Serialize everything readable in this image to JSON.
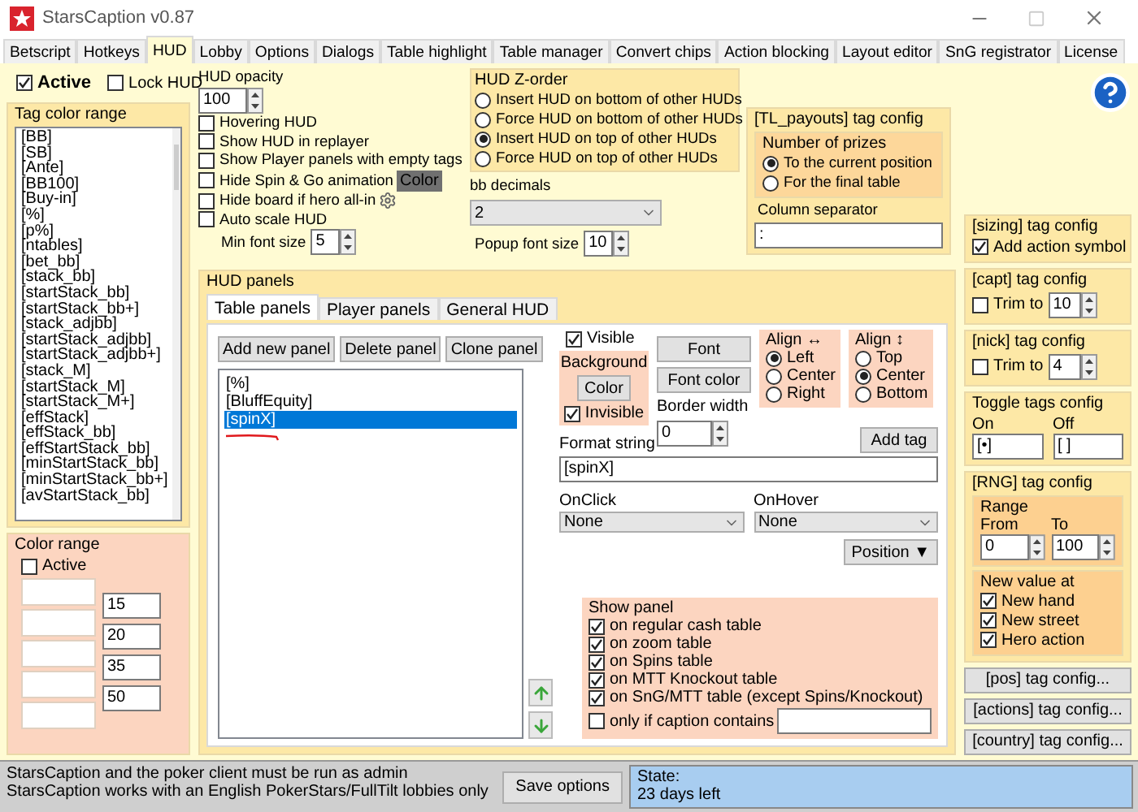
{
  "window": {
    "title": "StarsCaption v0.87"
  },
  "tabs": [
    {
      "label": "Betscript",
      "selected": false
    },
    {
      "label": "Hotkeys",
      "selected": false
    },
    {
      "label": "HUD",
      "selected": true
    },
    {
      "label": "Lobby",
      "selected": false
    },
    {
      "label": "Options",
      "selected": false
    },
    {
      "label": "Dialogs",
      "selected": false
    },
    {
      "label": "Table highlight",
      "selected": false
    },
    {
      "label": "Table manager",
      "selected": false
    },
    {
      "label": "Convert chips",
      "selected": false
    },
    {
      "label": "Action blocking",
      "selected": false
    },
    {
      "label": "Layout editor",
      "selected": false
    },
    {
      "label": "SnG registrator",
      "selected": false
    },
    {
      "label": "License",
      "selected": false
    }
  ],
  "left": {
    "active": {
      "label": "Active",
      "checked": true
    },
    "lock_hud": {
      "label": "Lock HUD",
      "checked": false
    },
    "tag_color_range": {
      "title": "Tag color range",
      "items": [
        "[BB]",
        "[SB]",
        "[Ante]",
        "[BB100]",
        "[Buy-in]",
        "[%]",
        "[p%]",
        "[ntables]",
        "[bet_bb]",
        "[stack_bb]",
        "[startStack_bb]",
        "[startStack_bb+]",
        "[stack_adjbb]",
        "[startStack_adjbb]",
        "[startStack_adjbb+]",
        "[stack_M]",
        "[startStack_M]",
        "[startStack_M+]",
        "[effStack]",
        "[effStack_bb]",
        "[effStartStack_bb]",
        "[minStartStack_bb]",
        "[minStartStack_bb+]",
        "[avStartStack_bb]"
      ]
    },
    "color_range": {
      "title": "Color range",
      "active": {
        "label": "Active",
        "checked": false
      },
      "thresholds": [
        "15",
        "20",
        "35",
        "50"
      ]
    }
  },
  "settings": {
    "hud_opacity": {
      "label": "HUD opacity",
      "value": "100"
    },
    "options": [
      {
        "label": "Hovering HUD",
        "checked": false,
        "kind": "plain"
      },
      {
        "label": "Show HUD in replayer",
        "checked": false,
        "kind": "plain"
      },
      {
        "label": "Show Player panels with empty tags",
        "checked": false,
        "kind": "plain"
      },
      {
        "label": "Hide Spin & Go animation",
        "checked": false,
        "kind": "button",
        "button": "Color"
      },
      {
        "label": "Hide board if hero all-in",
        "checked": false,
        "kind": "gear"
      },
      {
        "label": "Auto scale HUD",
        "checked": false,
        "kind": "plain"
      }
    ],
    "min_font_size": {
      "label": "Min font size",
      "value": "5"
    }
  },
  "z_order": {
    "title": "HUD Z-order",
    "options": [
      {
        "label": "Insert HUD on bottom of other HUDs",
        "selected": false
      },
      {
        "label": "Force HUD on bottom of other HUDs",
        "selected": false
      },
      {
        "label": "Insert HUD on top of other HUDs",
        "selected": true
      },
      {
        "label": "Force HUD on top of other HUDs",
        "selected": false
      }
    ]
  },
  "bb_decimals": {
    "label": "bb decimals",
    "value": "2"
  },
  "popup_font_size": {
    "label": "Popup font size",
    "value": "10"
  },
  "tl_payouts": {
    "title": "[TL_payouts] tag config",
    "prizes": {
      "title": "Number of prizes",
      "options": [
        {
          "label": "To the current position",
          "selected": true
        },
        {
          "label": "For the final table",
          "selected": false
        }
      ]
    },
    "separator": {
      "label": "Column separator",
      "value": ":"
    }
  },
  "hud_panels": {
    "title": "HUD panels",
    "tabs": [
      {
        "label": "Table panels",
        "selected": true
      },
      {
        "label": "Player panels",
        "selected": false
      },
      {
        "label": "General HUD",
        "selected": false
      }
    ],
    "buttons": [
      "Add new panel",
      "Delete panel",
      "Clone panel"
    ],
    "panels": [
      {
        "text": "[%]",
        "selected": false
      },
      {
        "text": "[BluffEquity]",
        "selected": false
      },
      {
        "text": "[spinX]",
        "selected": true
      }
    ],
    "visible": {
      "label": "Visible",
      "checked": true
    },
    "background": {
      "title": "Background",
      "button": "Color",
      "invisible": {
        "label": "Invisible",
        "checked": true
      }
    },
    "font_button": "Font",
    "font_color_button": "Font color",
    "border_width": {
      "label": "Border width",
      "value": "0"
    },
    "align_h": {
      "title": "Align ↔",
      "options": [
        {
          "label": "Left",
          "selected": true
        },
        {
          "label": "Center",
          "selected": false
        },
        {
          "label": "Right",
          "selected": false
        }
      ]
    },
    "align_v": {
      "title": "Align ↕",
      "options": [
        {
          "label": "Top",
          "selected": false
        },
        {
          "label": "Center",
          "selected": true
        },
        {
          "label": "Bottom",
          "selected": false
        }
      ]
    },
    "add_tag": "Add tag",
    "format_string": {
      "label": "Format string",
      "value": "[spinX]"
    },
    "on_click": {
      "label": "OnClick",
      "value": "None"
    },
    "on_hover": {
      "label": "OnHover",
      "value": "None"
    },
    "position_button": "Position ▼",
    "show_panel": {
      "title": "Show panel",
      "options": [
        {
          "label": "on regular cash table",
          "checked": true
        },
        {
          "label": "on zoom table",
          "checked": true
        },
        {
          "label": "on Spins table",
          "checked": true
        },
        {
          "label": "on MTT Knockout table",
          "checked": true
        },
        {
          "label": "on SnG/MTT table (except Spins/Knockout)",
          "checked": true
        }
      ],
      "caption_filter": {
        "label": "only if caption contains",
        "checked": false
      }
    }
  },
  "right": {
    "sizing": {
      "title": "[sizing] tag config",
      "add_action_symbol": {
        "label": "Add action symbol",
        "checked": true
      }
    },
    "capt": {
      "title": "[capt] tag config",
      "trim": {
        "label": "Trim to",
        "checked": false,
        "value": "10"
      }
    },
    "nick": {
      "title": "[nick] tag config",
      "trim": {
        "label": "Trim to",
        "checked": false,
        "value": "4"
      }
    },
    "toggle": {
      "title": "Toggle tags config",
      "on_label": "On",
      "on_value": "[•]",
      "off_label": "Off",
      "off_value": "[ ]"
    },
    "rng": {
      "title": "[RNG] tag config",
      "range": {
        "title": "Range",
        "from_label": "From",
        "from_value": "0",
        "to_label": "To",
        "to_value": "100"
      },
      "new_value": {
        "title": "New value at",
        "options": [
          {
            "label": "New hand",
            "checked": true
          },
          {
            "label": "New street",
            "checked": true
          },
          {
            "label": "Hero action",
            "checked": true
          }
        ]
      }
    },
    "buttons": [
      "[pos] tag config...",
      "[actions] tag config...",
      "[country] tag config..."
    ]
  },
  "status": {
    "messages": [
      "StarsCaption and the poker client must be run as admin",
      "StarsCaption works with an English PokerStars/FullTilt lobbies only"
    ],
    "save_button": "Save options",
    "state": [
      "State:",
      "23 days left"
    ]
  }
}
